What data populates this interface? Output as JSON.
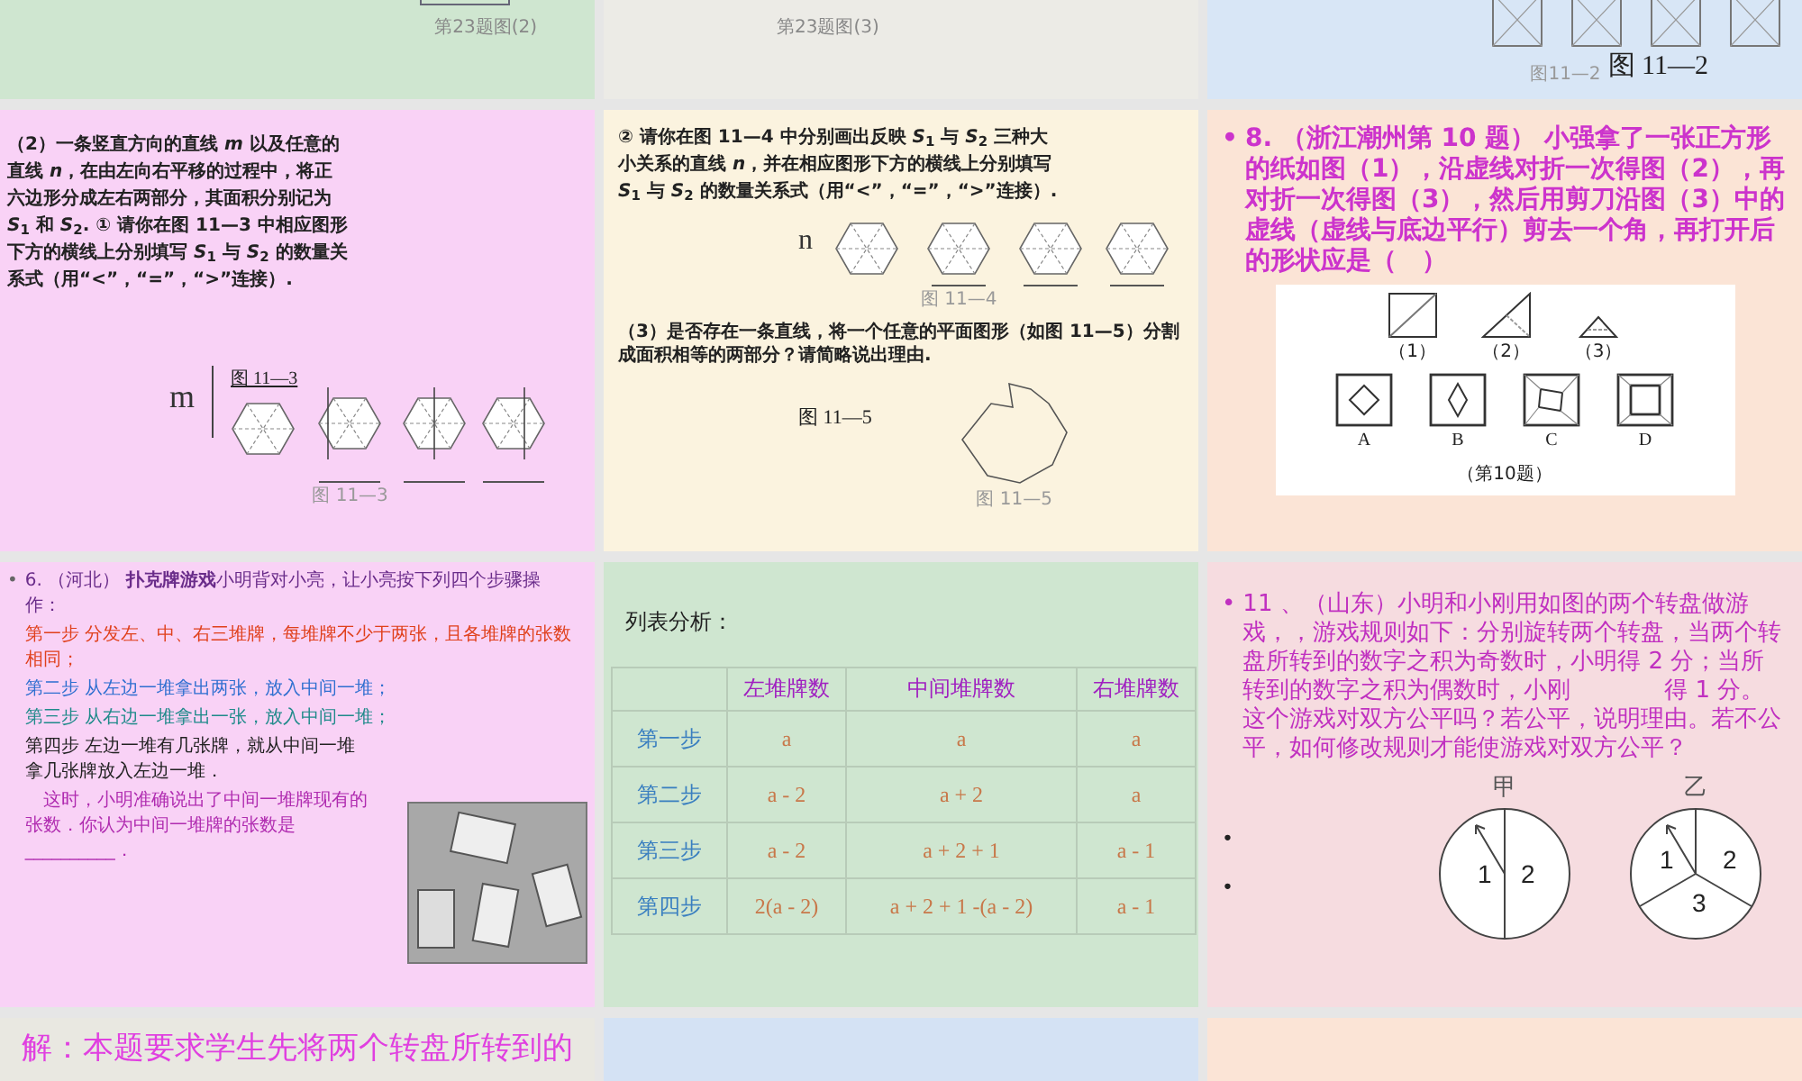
{
  "slides": [
    {
      "kind": "caption",
      "caption": "第23题图(2)"
    },
    {
      "kind": "caption",
      "caption": "第23题图(3)"
    },
    {
      "kind": "squares",
      "small_caption": "图11—2",
      "caption": "图 11—2"
    },
    {
      "kind": "hexagon-question",
      "text": "（2）一条竖直方向的直线 *m* 以及任意的直线 *n*，在由左向右平移的过程中，将正六边形分成左右两部分，其面积分别记为 *S*$_{1}$ 和 *S*$_{2}$. ① 请你在图 11—3 中相应图形下方的横线上分别填写 *S*$_{1}$ 与 *S*$_{2}$ 的数量关系式（用“<”，“=”，“>”连接）.",
      "line_label": "m",
      "figure_label": "图 11—3",
      "small_caption": "图 11—3"
    },
    {
      "kind": "hexagon-lines",
      "text": "② 请你在图 11—4 中分别画出反映 *S*$_{1}$ 与 *S*$_{2}$ 三种大小关系的直线 *n*，并在相应图形下方的横线上分别填写 *S*$_{1}$ 与 *S*$_{2}$ 的数量关系式（用“<”，“=”，“>”连接）.",
      "line_label": "n",
      "small_caption": "图 11—4",
      "question": "（3）是否存在一条直线，将一个任意的平面图形（如图 11—5）分割成面积相等的两部分？请简略说出理由.",
      "figure_label": "图 11—5",
      "polygon_caption": "图 11—5"
    },
    {
      "kind": "folding",
      "bullet": "•",
      "text": "8. （浙江潮州第 10 题） 小强拿了一张正方形的纸如图（1），沿虚线对折一次得图（2），再对折一次得图（3），然后用剪刀沿图（3）中的虚线（虚线与底边平行）剪去一个角，再打开后的形状应是（　）",
      "step_labels": [
        "（1）",
        "（2）",
        "（3）"
      ],
      "choice_labels": [
        "A",
        "B",
        "C",
        "D"
      ],
      "figure_caption": "（第10题）"
    },
    {
      "kind": "cards",
      "bullet": "•",
      "lines": [
        {
          "text": "6. （河北） **扑克牌游戏**小明背对小亮，让小亮按下列四个步骤操作：",
          "color": "#6a2c8a"
        },
        {
          "text": "第一步 分发左、中、右三堆牌，每堆牌不少于两张，且各堆牌的张数相同；",
          "color": "#e0401c"
        },
        {
          "text": "第二步 从左边一堆拿出两张，放入中间一堆；",
          "color": "#2f6fd0"
        },
        {
          "text": "第三步 从右边一堆拿出一张，放入中间一堆；",
          "color": "#1f8a8a"
        },
        {
          "text": "第四步 左边一堆有几张牌，就从中间一堆拿几张牌放入左边一堆．",
          "color": "#222222"
        },
        {
          "text": "　这时，小明准确说出了中间一堆牌现有的张数．你认为中间一堆牌的张数是__________．",
          "color": "#b02cb0"
        }
      ]
    },
    {
      "kind": "table",
      "title": "列表分析：",
      "columns": [
        "左堆牌数",
        "中间堆牌数",
        "右堆牌数"
      ],
      "rows": [
        {
          "step": "第一步",
          "cells": [
            "a",
            "a",
            "a"
          ]
        },
        {
          "step": "第二步",
          "cells": [
            "a - 2",
            "a + 2",
            "a"
          ]
        },
        {
          "step": "第三步",
          "cells": [
            "a - 2",
            "a + 2 + 1",
            "a - 1"
          ]
        },
        {
          "step": "第四步",
          "cells": [
            "2(a - 2)",
            "a + 2 + 1 -(a - 2)",
            "a - 1"
          ]
        }
      ]
    },
    {
      "kind": "spinners",
      "bullet": "•",
      "text": "11 、（山东）小明和小刚用如图的两个转盘做游戏，，游戏规则如下：分别旋转两个转盘，当两个转盘所转到的数字之积为奇数时，小明得 2 分；当所转到的数字之积为偶数时，小刚　　　　得 1 分。这个游戏对双方公平吗？若公平，说明理由。若不公平，如何修改规则才能使游戏对双方公平？",
      "extra_bullets": [
        "•",
        "•"
      ],
      "spinners": [
        {
          "label": "甲",
          "numbers": [
            "1",
            "2"
          ]
        },
        {
          "label": "乙",
          "numbers": [
            "1",
            "2",
            "3"
          ]
        }
      ]
    },
    {
      "kind": "solution",
      "text": "解：本题要求学生先将两个转盘所转到的"
    },
    {
      "kind": "blank"
    },
    {
      "kind": "blank"
    }
  ]
}
